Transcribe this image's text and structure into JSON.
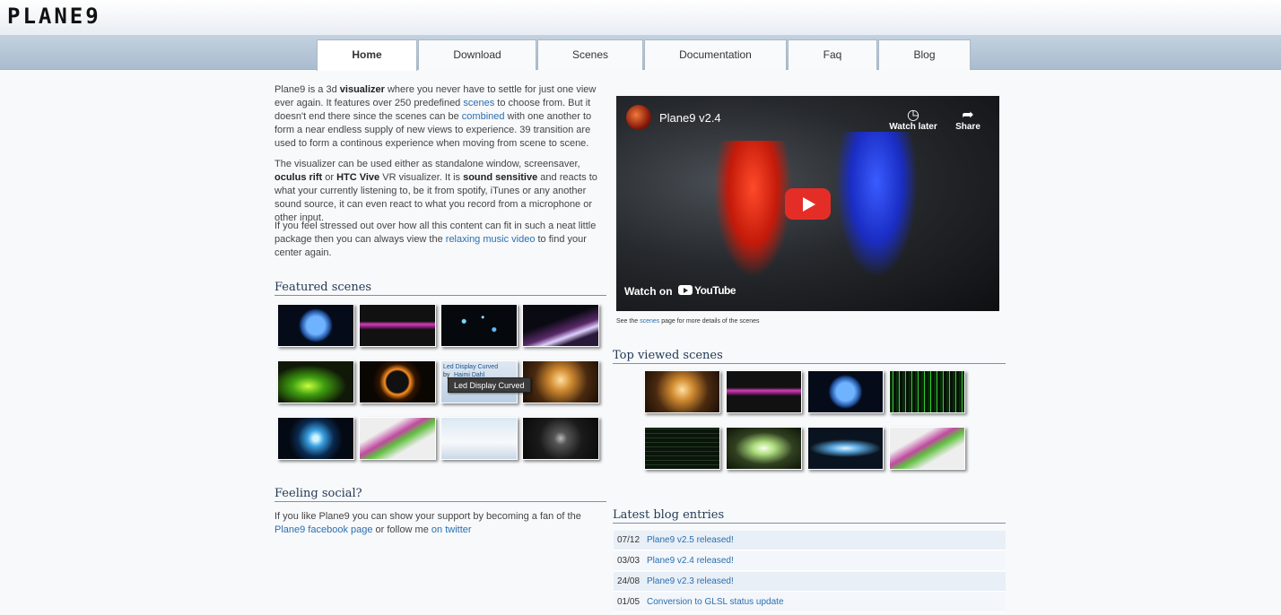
{
  "header": {
    "logo_text": "PLANE9"
  },
  "nav": {
    "tabs": [
      {
        "label": "Home",
        "active": true
      },
      {
        "label": "Download"
      },
      {
        "label": "Scenes"
      },
      {
        "label": "Documentation"
      },
      {
        "label": "Faq"
      },
      {
        "label": "Blog"
      }
    ]
  },
  "intro": {
    "p1": {
      "t1": "Plane9 is a 3d ",
      "b1": "visualizer",
      "t2": " where you never have to settle for just one view ever again. It features over 250 predefined ",
      "l1": "scenes",
      "t3": " to choose from. But it doesn't end there since the scenes can be ",
      "l2": "combined",
      "t4": " with one another to form a near endless supply of new views to experience. 39 transition are used to form a continous experience when moving from scene to scene."
    },
    "p2": {
      "t1": "The visualizer can be used either as standalone window, screensaver, ",
      "b1": "oculus rift",
      "t2": " or ",
      "b2": "HTC Vive",
      "t3": " VR visualizer. It is ",
      "b3": "sound sensitive",
      "t4": " and reacts to what your currently listening to, be it from spotify, iTunes or any another sound source, it can even react to what you record from a microphone or other input."
    },
    "p3": {
      "t1": "If you feel stressed out over how all this content can fit in such a neat little package then you can always view the ",
      "l1": "relaxing music video",
      "t2": " to find your center again."
    }
  },
  "featured": {
    "heading": "Featured scenes",
    "caption": {
      "title": "Led Display Curved",
      "by": "by",
      "author": "Haimi Dahl"
    },
    "tooltip": "Led Display Curved"
  },
  "social": {
    "heading": "Feeling social?",
    "t1": "If you like Plane9 you can show your support by becoming a fan of the ",
    "l1": "Plane9 facebook page",
    "t2": " or follow me ",
    "l2": "on twitter"
  },
  "video": {
    "title": "Plane9 v2.4",
    "watch_later": "Watch later",
    "share": "Share",
    "watch_on": "Watch on",
    "youtube": "YouTube"
  },
  "scenes_note": {
    "t1": "See the ",
    "l1": "scenes",
    "t2": " page for more details of the scenes"
  },
  "top_viewed": {
    "heading": "Top viewed scenes"
  },
  "blog": {
    "heading": "Latest blog entries",
    "entries": [
      {
        "date": "07/12",
        "title": "Plane9 v2.5 released!"
      },
      {
        "date": "03/03",
        "title": "Plane9 v2.4 released!"
      },
      {
        "date": "24/08",
        "title": "Plane9 v2.3 released!"
      },
      {
        "date": "01/05",
        "title": "Conversion to GLSL status update"
      }
    ]
  },
  "colors": {
    "link": "#2a6fb0",
    "heading": "#233a55",
    "nav_band": "#aebfd1",
    "youtube_red": "#e52d27"
  }
}
